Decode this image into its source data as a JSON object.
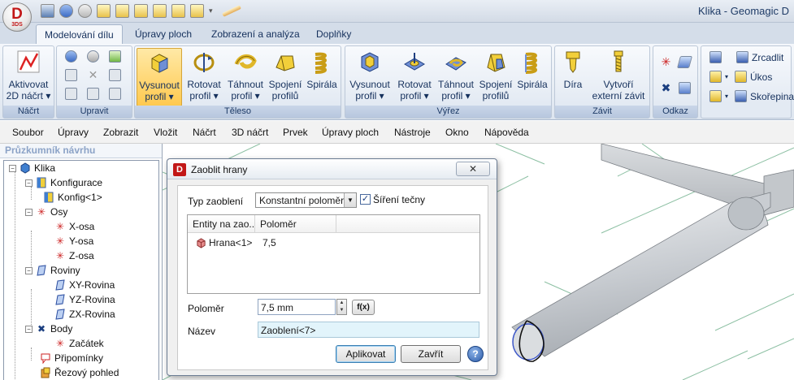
{
  "app": {
    "logo_text": "D",
    "logo_sub": "3DS",
    "window_title": "Klika - Geomagic D"
  },
  "ribbon_tabs": [
    {
      "label": "Modelování dílu",
      "active": true
    },
    {
      "label": "Úpravy ploch",
      "active": false
    },
    {
      "label": "Zobrazení a analýza",
      "active": false
    },
    {
      "label": "Doplňky",
      "active": false
    }
  ],
  "ribbon": {
    "groups": {
      "nacrt": "Náčrt",
      "upravit": "Upravit",
      "teleso": "Těleso",
      "vyrez": "Výřez",
      "zavit": "Závit",
      "odkaz": "Odkaz"
    },
    "nacrt_btn": {
      "line1": "Aktivovat",
      "line2": "2D náčrt"
    },
    "teleso": [
      {
        "line1": "Vysunout",
        "line2": "profil"
      },
      {
        "line1": "Rotovat",
        "line2": "profil"
      },
      {
        "line1": "Táhnout",
        "line2": "profil"
      },
      {
        "line1": "Spojení",
        "line2": "profilů"
      },
      {
        "line1": "Spirála",
        "line2": ""
      }
    ],
    "vyrez": [
      {
        "line1": "Vysunout",
        "line2": "profil"
      },
      {
        "line1": "Rotovat",
        "line2": "profil"
      },
      {
        "line1": "Táhnout",
        "line2": "profil"
      },
      {
        "line1": "Spojení",
        "line2": "profilů"
      },
      {
        "line1": "Spirála",
        "line2": ""
      }
    ],
    "zavit": [
      {
        "line1": "Díra",
        "line2": ""
      },
      {
        "line1": "Vytvoří",
        "line2": "externí závit"
      }
    ],
    "right_small": [
      "Zrcadlit",
      "Úkos",
      "Skořepina"
    ]
  },
  "menu": [
    "Soubor",
    "Úpravy",
    "Zobrazit",
    "Vložit",
    "Náčrt",
    "3D náčrt",
    "Prvek",
    "Úpravy ploch",
    "Nástroje",
    "Okno",
    "Nápověda"
  ],
  "explorer": {
    "title": "Průzkumník návrhu",
    "tree": [
      {
        "label": "Klika",
        "icon": "part-icon"
      },
      {
        "label": "Konfigurace",
        "icon": "config-icon"
      },
      {
        "label": "Konfig<1>",
        "icon": "config-icon"
      },
      {
        "label": "Osy",
        "icon": "axis-icon"
      },
      {
        "label": "X-osa",
        "icon": "axis-icon"
      },
      {
        "label": "Y-osa",
        "icon": "axis-icon"
      },
      {
        "label": "Z-osa",
        "icon": "axis-icon"
      },
      {
        "label": "Roviny",
        "icon": "plane-icon"
      },
      {
        "label": "XY-Rovina",
        "icon": "plane-icon"
      },
      {
        "label": "YZ-Rovina",
        "icon": "plane-icon"
      },
      {
        "label": "ZX-Rovina",
        "icon": "plane-icon"
      },
      {
        "label": "Body",
        "icon": "point-icon"
      },
      {
        "label": "Začátek",
        "icon": "point-icon"
      },
      {
        "label": "Připomínky",
        "icon": "note-icon"
      },
      {
        "label": "Řezový pohled",
        "icon": "section-icon"
      }
    ]
  },
  "dialog": {
    "title": "Zaoblit hrany",
    "close": "✕",
    "type_label": "Typ zaoblení",
    "type_value": "Konstantní poloměr",
    "tangent_label": "Šíření tečny",
    "tangent_checked": true,
    "table_headers": [
      "Entity na zao...",
      "Poloměr"
    ],
    "table_rows": [
      {
        "entity": "Hrana<1>",
        "radius": "7,5"
      }
    ],
    "radius_label": "Poloměr",
    "radius_value": "7,5 mm",
    "fx_label": "f(x)",
    "name_label": "Název",
    "name_value": "Zaoblení<7>",
    "apply": "Aplikovat",
    "close_btn": "Zavřít",
    "help": "?"
  },
  "colors": {
    "accent": "#1d3a66",
    "selected_button": "#ffc94f",
    "brand_red": "#c21818"
  }
}
